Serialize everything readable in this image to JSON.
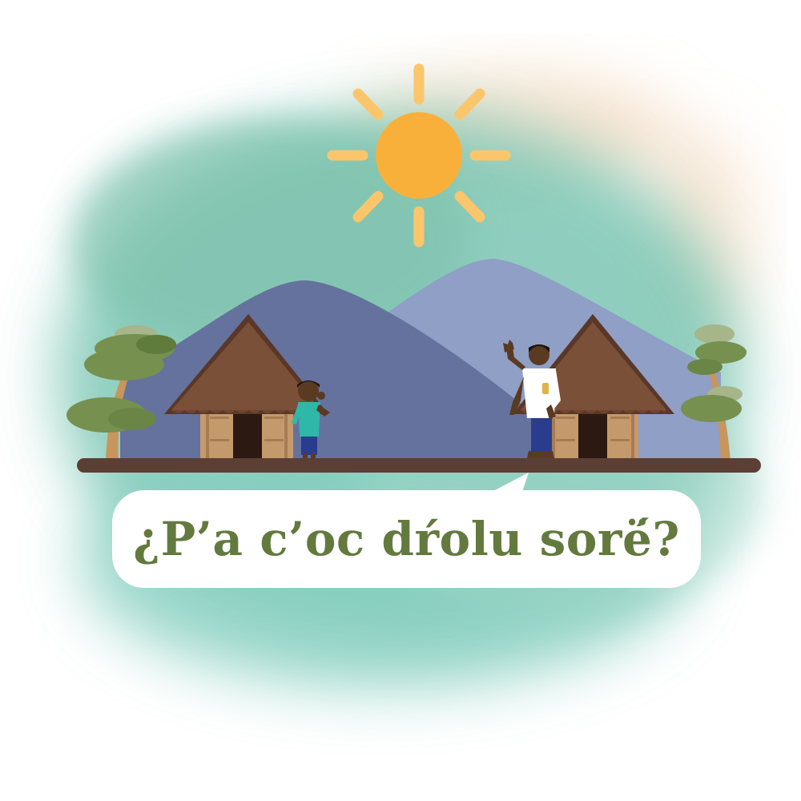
{
  "caption": {
    "text": "¿P’a c’oc dŕolu sorё́?"
  },
  "colors": {
    "background": "#ffffff",
    "watercolor_teal": "#7cc6b4",
    "watercolor_peach": "#f3d9bd",
    "sun": "#f9b03b",
    "sun_rays": "#fbc66b",
    "mountain_dark": "#64729d",
    "mountain_light": "#8f9fc5",
    "roof": "#7a5038",
    "roof_edge": "#5a3727",
    "hut_wall": "#c49a6c",
    "hut_wall_stripe": "#a77c52",
    "door": "#2c1a12",
    "tree_foliage": "#76904f",
    "tree_foliage_light": "#a6b58a",
    "tree_trunk": "#c8955d",
    "ground": "#5b3f35",
    "bubble": "#ffffff",
    "caption_text": "#637a3e",
    "skin": "#5b3a22",
    "boy_shirt": "#2fb7a9",
    "boy_shorts": "#2a3c8e",
    "man_shirt": "#ffffff",
    "man_pants": "#2a3c8e"
  },
  "elements": {
    "sun": "sun-icon",
    "left_hut": "hut-icon",
    "right_hut": "hut-icon",
    "boy": "boy-figure",
    "man": "man-waving-figure",
    "left_tree": "tree-icon",
    "right_tree": "tree-icon",
    "mountains": "mountain-icon"
  }
}
